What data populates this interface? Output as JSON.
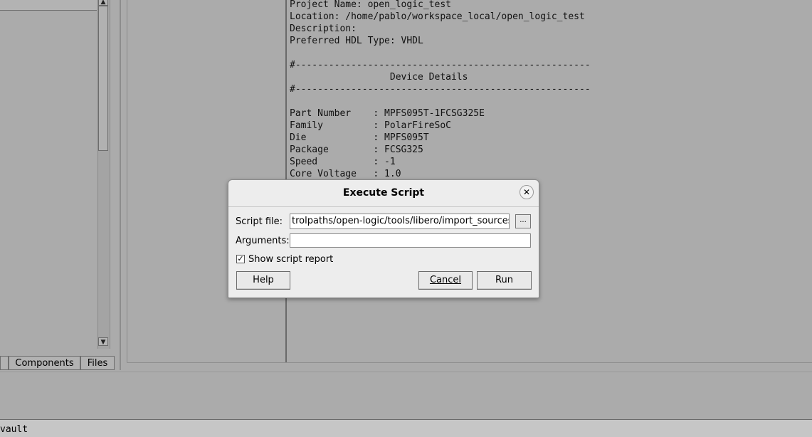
{
  "left_panel": {
    "tabs": [
      {
        "label": ""
      },
      {
        "label": "Components"
      },
      {
        "label": "Files"
      }
    ],
    "scroll_up_icon": "triangle-up",
    "scroll_down_icon": "triangle-down"
  },
  "log": {
    "lines": [
      "Project Name: open_logic_test",
      "Location: /home/pablo/workspace_local/open_logic_test",
      "Description:",
      "Preferred HDL Type: VHDL",
      "",
      "#-----------------------------------------------------",
      "                  Device Details",
      "#-----------------------------------------------------",
      "",
      "Part Number    : MPFS095T-1FCSG325E",
      "Family         : PolarFireSoC",
      "Die            : MPFS095T",
      "Package        : FCSG325",
      "Speed          : -1",
      "Core Voltage   : 1.0"
    ]
  },
  "status_bar": {
    "text": "vault"
  },
  "dialog": {
    "title": "Execute Script",
    "close_icon": "close-x",
    "script_file_label": "Script file:",
    "script_file_value": "trolpaths/open-logic/tools/libero/import_sources.tcl",
    "browse_label": "...",
    "arguments_label": "Arguments:",
    "arguments_value": "",
    "show_report_label": "Show script report",
    "show_report_checked": true,
    "help_label": "Help",
    "cancel_label": "Cancel",
    "run_label": "Run"
  }
}
